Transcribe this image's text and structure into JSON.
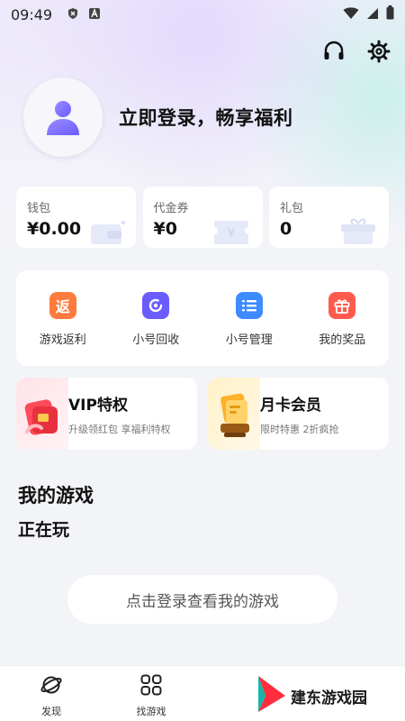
{
  "status_bar": {
    "time": "09:49",
    "icons": [
      "shield-x-icon",
      "font-a-icon",
      "wifi-icon",
      "signal-icon",
      "battery-icon"
    ]
  },
  "header": {
    "icons": [
      "headset-icon",
      "gear-icon"
    ]
  },
  "profile": {
    "login_prompt": "立即登录，畅享福利"
  },
  "wallet": [
    {
      "label": "钱包",
      "value": "¥0.00",
      "icon": "wallet-icon"
    },
    {
      "label": "代金券",
      "value": "¥0",
      "icon": "coupon-icon"
    },
    {
      "label": "礼包",
      "value": "0",
      "icon": "gift-box-icon"
    }
  ],
  "services": [
    {
      "label": "游戏返利",
      "glyph": "返",
      "color": "#ff7a3d",
      "icon": "rebate-icon"
    },
    {
      "label": "小号回收",
      "color": "#6a5cff",
      "icon": "recycle-icon"
    },
    {
      "label": "小号管理",
      "color": "#3d8bff",
      "icon": "list-icon"
    },
    {
      "label": "我的奖品",
      "color": "#ff5a4e",
      "icon": "gift-icon"
    }
  ],
  "promos": [
    {
      "title": "VIP特权",
      "subtitle": "升级领红包 享福利特权",
      "icon": "vip-redpacket-icon"
    },
    {
      "title": "月卡会员",
      "subtitle": "限时特惠 2折疯抢",
      "icon": "monthly-card-icon"
    }
  ],
  "my_games": {
    "title": "我的游戏",
    "playing": "正在玩",
    "login_button": "点击登录查看我的游戏"
  },
  "bottom_nav": [
    {
      "label": "发现",
      "icon": "planet-icon"
    },
    {
      "label": "找游戏",
      "icon": "grid-icon"
    }
  ],
  "watermark": {
    "text": "建东游戏园"
  },
  "colors": {
    "accent": "#6a5cff",
    "background": "#f3f4f7"
  }
}
